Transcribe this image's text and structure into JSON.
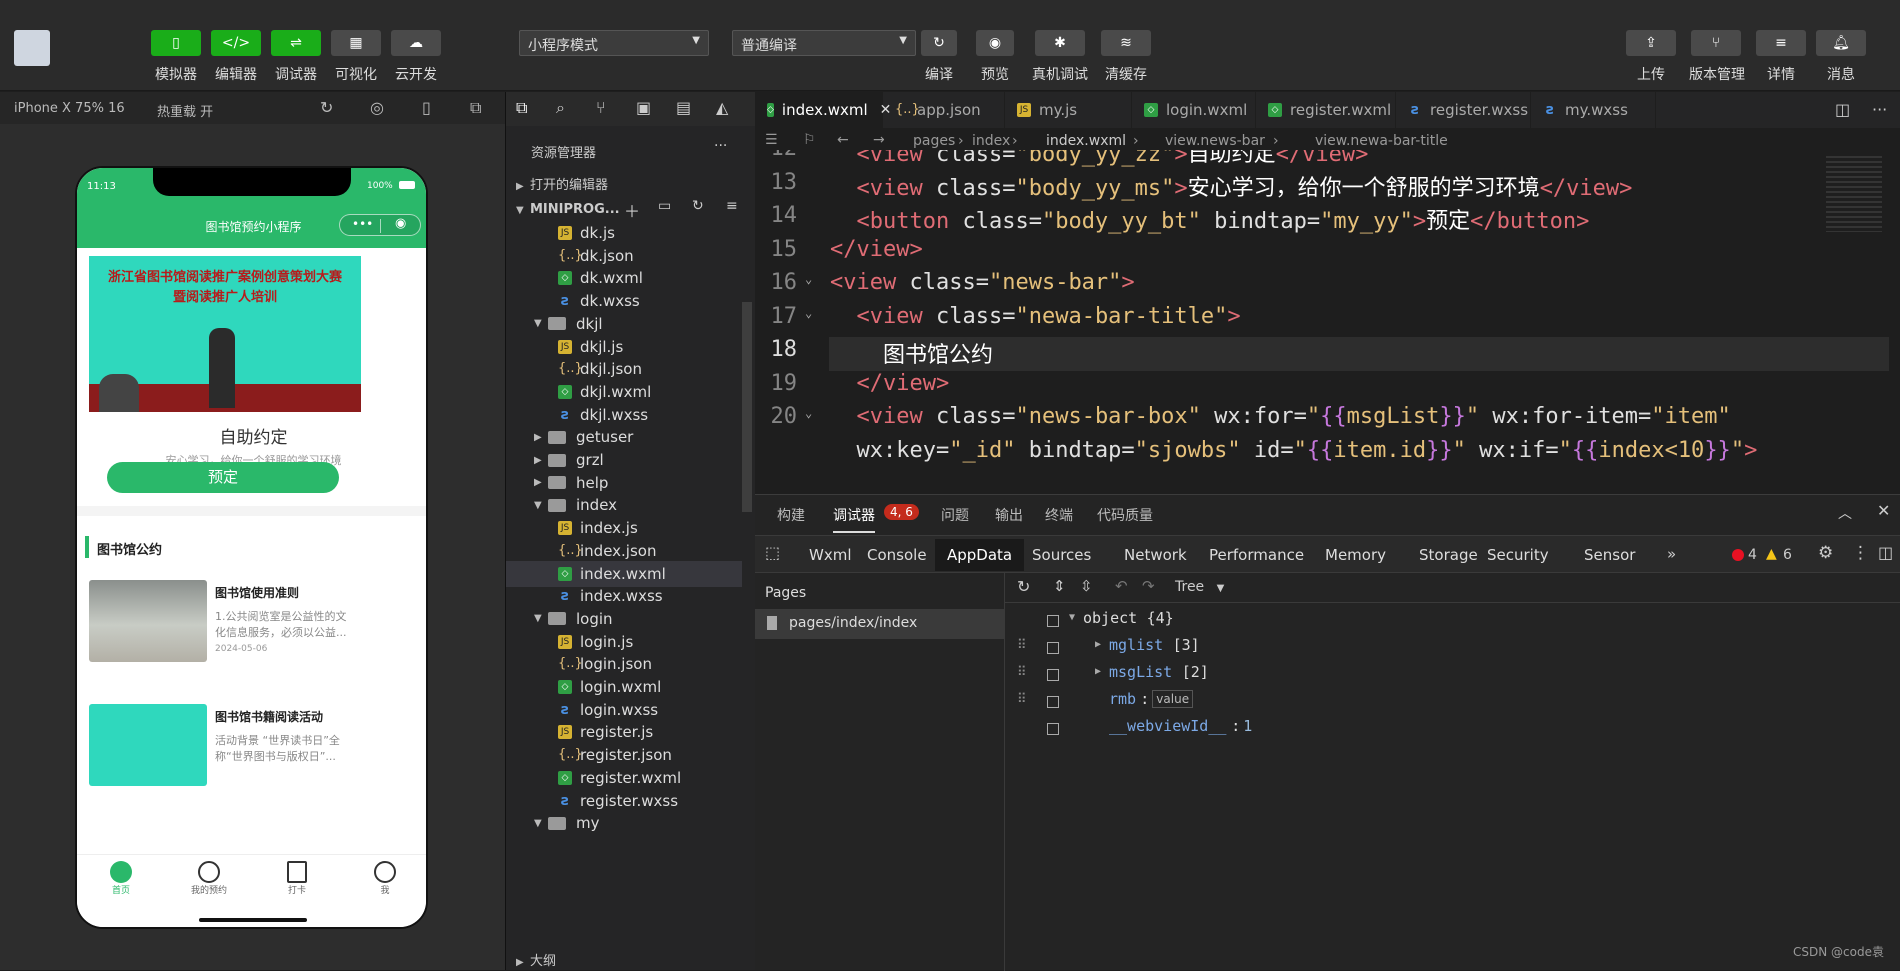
{
  "toolbar": {
    "left_buttons": [
      {
        "label": "模拟器",
        "icon": "phone-icon"
      },
      {
        "label": "编辑器",
        "icon": "code-icon"
      },
      {
        "label": "调试器",
        "icon": "debug-icon"
      },
      {
        "label": "可视化",
        "icon": "visual-icon"
      },
      {
        "label": "云开发",
        "icon": "cloud-icon"
      }
    ],
    "mode_select": "小程序模式",
    "compile_select": "普通编译",
    "mid_buttons": [
      {
        "label": "编译"
      },
      {
        "label": "预览"
      },
      {
        "label": "真机调试"
      },
      {
        "label": "清缓存"
      }
    ],
    "right_buttons": [
      {
        "label": "上传"
      },
      {
        "label": "版本管理"
      },
      {
        "label": "详情"
      },
      {
        "label": "消息"
      }
    ]
  },
  "simulator": {
    "device": "iPhone X 75% 16",
    "hot_reload": "热重载 开",
    "status_time": "11:13",
    "battery": "100%",
    "nav_title": "图书馆预约小程序",
    "banner_line1": "浙江省图书馆阅读推广案例创意策划大赛",
    "banner_line2": "暨阅读推广人培训",
    "title": "自助约定",
    "subtitle": "安心学习，给你一个舒服的学习环境",
    "book_button": "预定",
    "section_title": "图书馆公约",
    "news": [
      {
        "title": "图书馆使用准则",
        "desc": "1.公共阅览室是公益性的文化信息服务，必须以公益...",
        "date": "2024-05-06"
      },
      {
        "title": "图书馆书籍阅读活动",
        "desc": "活动背景 “世界读书日”全称“世界图书与版权日”...",
        "date": ""
      }
    ],
    "tabbar": [
      "首页",
      "我的预约",
      "打卡",
      "我"
    ]
  },
  "explorer": {
    "title": "资源管理器",
    "open_editors": "打开的编辑器",
    "project": "MINIPROG...",
    "outline": "大纲",
    "files": [
      {
        "name": "dk.js",
        "type": "js",
        "depth": 2
      },
      {
        "name": "dk.json",
        "type": "json",
        "depth": 2
      },
      {
        "name": "dk.wxml",
        "type": "wxml",
        "depth": 2
      },
      {
        "name": "dk.wxss",
        "type": "wxss",
        "depth": 2
      },
      {
        "name": "dkjl",
        "type": "folder-open",
        "depth": 1
      },
      {
        "name": "dkjl.js",
        "type": "js",
        "depth": 2
      },
      {
        "name": "dkjl.json",
        "type": "json",
        "depth": 2
      },
      {
        "name": "dkjl.wxml",
        "type": "wxml",
        "depth": 2
      },
      {
        "name": "dkjl.wxss",
        "type": "wxss",
        "depth": 2
      },
      {
        "name": "getuser",
        "type": "folder",
        "depth": 1
      },
      {
        "name": "grzl",
        "type": "folder",
        "depth": 1
      },
      {
        "name": "help",
        "type": "folder",
        "depth": 1
      },
      {
        "name": "index",
        "type": "folder-open",
        "depth": 1
      },
      {
        "name": "index.js",
        "type": "js",
        "depth": 2
      },
      {
        "name": "index.json",
        "type": "json",
        "depth": 2
      },
      {
        "name": "index.wxml",
        "type": "wxml",
        "depth": 2,
        "selected": true
      },
      {
        "name": "index.wxss",
        "type": "wxss",
        "depth": 2
      },
      {
        "name": "login",
        "type": "folder-open",
        "depth": 1
      },
      {
        "name": "login.js",
        "type": "js",
        "depth": 2
      },
      {
        "name": "login.json",
        "type": "json",
        "depth": 2
      },
      {
        "name": "login.wxml",
        "type": "wxml",
        "depth": 2
      },
      {
        "name": "login.wxss",
        "type": "wxss",
        "depth": 2
      },
      {
        "name": "register.js",
        "type": "js",
        "depth": 2
      },
      {
        "name": "register.json",
        "type": "json",
        "depth": 2
      },
      {
        "name": "register.wxml",
        "type": "wxml",
        "depth": 2
      },
      {
        "name": "register.wxss",
        "type": "wxss",
        "depth": 2
      },
      {
        "name": "my",
        "type": "folder-open",
        "depth": 1
      }
    ]
  },
  "editor": {
    "tabs": [
      {
        "name": "index.wxml",
        "type": "wxml",
        "active": true
      },
      {
        "name": "app.json",
        "type": "json"
      },
      {
        "name": "my.js",
        "type": "js"
      },
      {
        "name": "login.wxml",
        "type": "wxml"
      },
      {
        "name": "register.wxml",
        "type": "wxml"
      },
      {
        "name": "register.wxss",
        "type": "wxss"
      },
      {
        "name": "my.wxss",
        "type": "wxss"
      }
    ],
    "breadcrumb": [
      "pages",
      "index",
      "index.wxml",
      "view.news-bar",
      "view.newa-bar-title"
    ],
    "lines": [
      {
        "n": "12",
        "html": "  <span class='t-tag'>&lt;view</span> <span class='t-attr'>class=</span><span class='t-str'>\"body_yy_zz\"</span><span class='t-tag'>&gt;</span><span class='t-txt'>自助约定</span><span class='t-tag'>&lt;/view&gt;</span>"
      },
      {
        "n": "13",
        "html": "  <span class='t-tag'>&lt;view</span> <span class='t-attr'>class=</span><span class='t-str'>\"body_yy_ms\"</span><span class='t-tag'>&gt;</span><span class='t-txt'>安心学习，给你一个舒服的学习环境</span><span class='t-tag'>&lt;/view&gt;</span>"
      },
      {
        "n": "14",
        "html": "  <span class='t-tag'>&lt;button</span> <span class='t-attr'>class=</span><span class='t-str'>\"body_yy_bt\"</span> <span class='t-attr'>bindtap=</span><span class='t-str'>\"my_yy\"</span><span class='t-tag'>&gt;</span><span class='t-txt'>预定</span><span class='t-tag'>&lt;/button&gt;</span>"
      },
      {
        "n": "15",
        "html": "<span class='t-tag'>&lt;/view&gt;</span>"
      },
      {
        "n": "16",
        "html": "<span class='t-tag'>&lt;view</span> <span class='t-attr'>class=</span><span class='t-str'>\"news-bar\"</span><span class='t-tag'>&gt;</span>"
      },
      {
        "n": "17",
        "html": "  <span class='t-tag'>&lt;view</span> <span class='t-attr'>class=</span><span class='t-str'>\"newa-bar-title\"</span><span class='t-tag'>&gt;</span>"
      },
      {
        "n": "18",
        "html": "    <span class='t-txt'>图书馆公约</span>"
      },
      {
        "n": "19",
        "html": "  <span class='t-tag'>&lt;/view&gt;</span>"
      },
      {
        "n": "20",
        "html": "  <span class='t-tag'>&lt;view</span> <span class='t-attr'>class=</span><span class='t-str'>\"news-bar-box\"</span> <span class='t-attr'>wx:for=</span><span class='t-str'>\"</span><span class='t-br'>{{</span><span class='t-str'>msgList</span><span class='t-br'>}}</span><span class='t-str'>\"</span> <span class='t-attr'>wx:for-item=</span><span class='t-str'>\"item\"</span>"
      },
      {
        "n": "",
        "html": "  <span class='t-attr'>wx:key=</span><span class='t-str'>\"_id\"</span> <span class='t-attr'>bindtap=</span><span class='t-str'>\"sjowbs\"</span> <span class='t-attr'>id=</span><span class='t-str'>\"</span><span class='t-br'>{{</span><span class='t-str'>item.id</span><span class='t-br'>}}</span><span class='t-str'>\"</span> <span class='t-attr'>wx:if=</span><span class='t-str'>\"</span><span class='t-br'>{{</span><span class='t-str'>index&lt;10</span><span class='t-br'>}}</span><span class='t-str'>\"</span><span class='t-tag'>&gt;</span>"
      }
    ]
  },
  "devtools": {
    "top_tabs": [
      "构建",
      "调试器",
      "问题",
      "输出",
      "终端",
      "代码质量"
    ],
    "badge": "4, 6",
    "panel_tabs": [
      "Wxml",
      "Console",
      "AppData",
      "Sources",
      "Network",
      "Performance",
      "Memory",
      "Storage",
      "Security",
      "Sensor"
    ],
    "errors": "4",
    "warnings": "6",
    "pages_header": "Pages",
    "page_path": "pages/index/index",
    "view_mode": "Tree",
    "tree": [
      {
        "key": "object",
        "val": "{4}"
      },
      {
        "key": "mglist",
        "val": "[3]"
      },
      {
        "key": "msgList",
        "val": "[2]"
      },
      {
        "key": "rmb",
        "val": "value"
      },
      {
        "key": "__webviewId__",
        "val": "1"
      }
    ]
  },
  "watermark": "CSDN @code袁"
}
